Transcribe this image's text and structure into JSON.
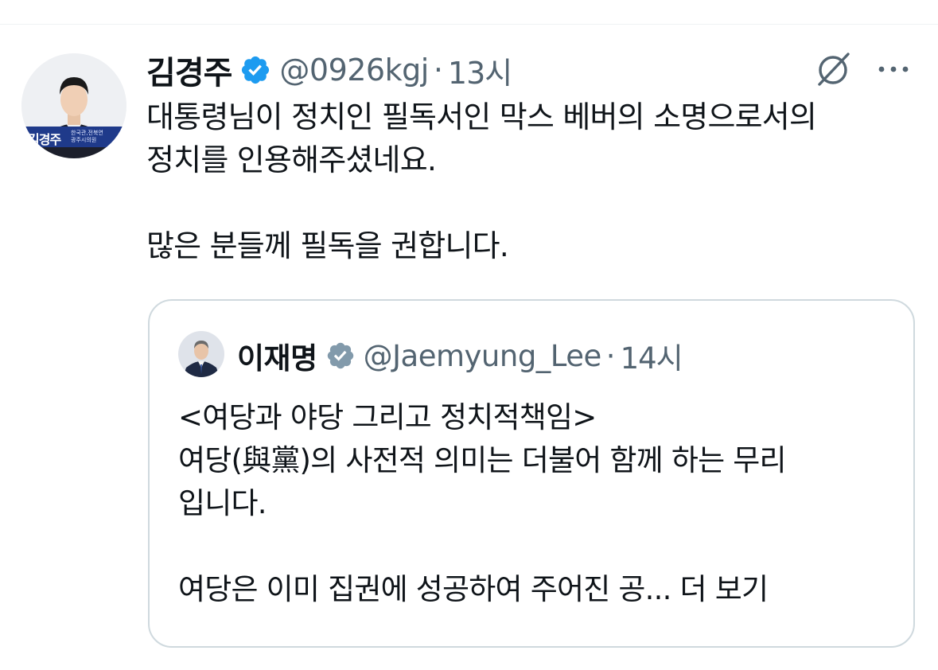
{
  "author": {
    "name": "김경주",
    "handle": "@0926kgj",
    "separator": "·",
    "time": "13시",
    "avatar_banner_name": "김경주",
    "avatar_banner_sub1": "한국관,전북연",
    "avatar_banner_sub2": "광주시의원"
  },
  "tweet": {
    "line1": "대통령님이 정치인 필독서인 막스 베버의 소명으로서의",
    "line2": "정치를 인용해주셨네요.",
    "line3": "많은 분들께 필독을 권합니다."
  },
  "quote": {
    "name": "이재명",
    "handle": "@Jaemyung_Lee",
    "separator": "·",
    "time": "14시",
    "line1": "<여당과 야당 그리고 정치적책임>",
    "line2": "여당(與黨)의 사전적 의미는 더불어 함께 하는 무리",
    "line3": "입니다.",
    "line4": "여당은 이미 집권에 성공하여 주어진 공...",
    "more_label": "더 보기"
  },
  "icons": {
    "verified": "verified-badge-icon",
    "verified_color": "#1d9bf0",
    "quote_verified_color": "#829aab",
    "grok": "grok-icon",
    "more": "more-options-icon"
  }
}
